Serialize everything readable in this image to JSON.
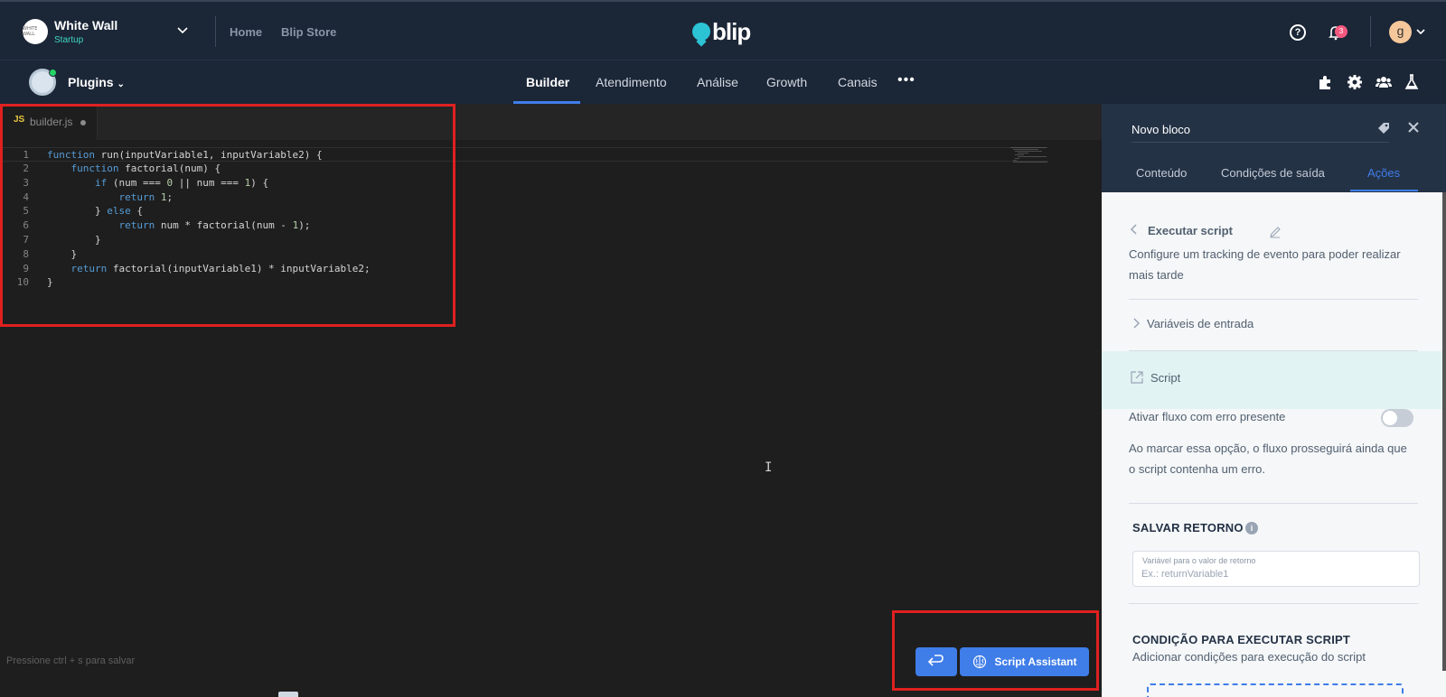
{
  "topbar": {
    "org_logo_text": "WHITE WALL",
    "org_name": "White Wall",
    "org_plan": "Startup",
    "links": [
      "Home",
      "Blip Store"
    ],
    "brand": "blip",
    "notification_count": "3",
    "avatar_letter": "g"
  },
  "navbar": {
    "plugins_label": "Plugins",
    "tabs": [
      "Builder",
      "Atendimento",
      "Análise",
      "Growth",
      "Canais"
    ],
    "more_label": "•••",
    "active_tab": "Builder",
    "right_icons": [
      "puzzle-icon",
      "gear-icon",
      "team-icon",
      "flask-icon"
    ]
  },
  "editor": {
    "tab_lang": "JS",
    "filename": "builder.js",
    "code_lines": [
      {
        "n": "1",
        "t": "function run(inputVariable1, inputVariable2) {"
      },
      {
        "n": "2",
        "t": "    function factorial(num) {"
      },
      {
        "n": "3",
        "t": "        if (num === 0 || num === 1) {"
      },
      {
        "n": "4",
        "t": "            return 1;"
      },
      {
        "n": "5",
        "t": "        } else {"
      },
      {
        "n": "6",
        "t": "            return num * factorial(num - 1);"
      },
      {
        "n": "7",
        "t": "        }"
      },
      {
        "n": "8",
        "t": "    }"
      },
      {
        "n": "9",
        "t": "    return factorial(inputVariable1) * inputVariable2;"
      },
      {
        "n": "10",
        "t": "}"
      }
    ],
    "save_hint": "Pressione ctrl + s para salvar",
    "text_cursor": "I",
    "assistant_label": "Script Assistant"
  },
  "panel": {
    "block_name": "Novo bloco",
    "tabs": [
      "Conteúdo",
      "Condições de saída",
      "Ações"
    ],
    "active_tab": "Ações",
    "action_title": "Executar script",
    "action_desc_1": "Configure um tracking de evento para poder realizar",
    "action_desc_2": "mais tarde",
    "input_vars_label": "Variáveis de entrada",
    "script_label": "Script",
    "error_flow_label": "Ativar fluxo com erro presente",
    "error_flow_desc_1": "Ao marcar essa opção, o fluxo prosseguirá ainda que",
    "error_flow_desc_2": "o script contenha um erro.",
    "save_return_title": "SALVAR RETORNO",
    "return_input_label": "Variável para o valor de retorno",
    "return_input_placeholder": "Ex.: returnVariable1",
    "return_input_value": "",
    "condition_title": "CONDIÇÃO PARA EXECUTAR SCRIPT",
    "condition_desc": "Adicionar condições para execução do script"
  },
  "colors": {
    "header_bg": "#1b2637",
    "editor_bg": "#1e1e1e",
    "accent": "#3f7de8",
    "brand_teal": "#2cc3d5",
    "highlight_red": "#e02020"
  }
}
